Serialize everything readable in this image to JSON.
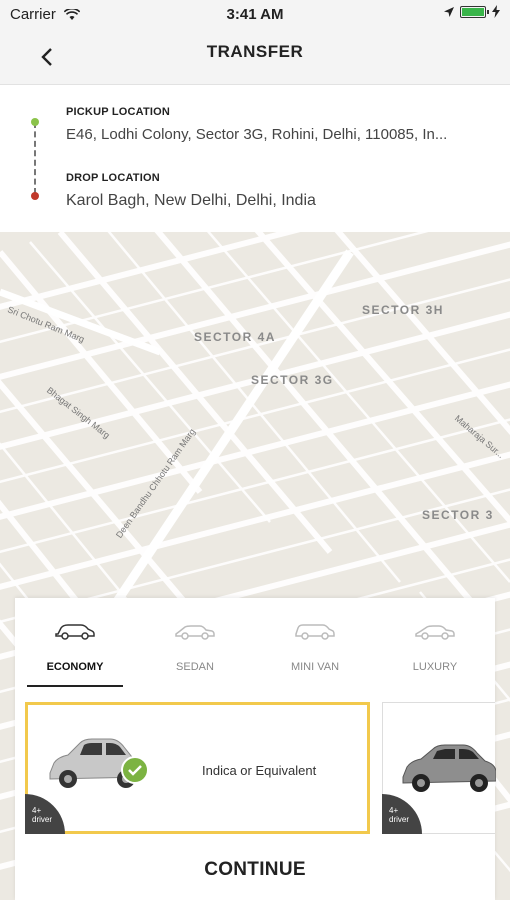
{
  "status_bar": {
    "carrier": "Carrier",
    "time": "3:41 AM",
    "icons": [
      "wifi-icon",
      "location-arrow-icon",
      "battery-icon",
      "charging-icon"
    ],
    "battery_color": "#39b54a"
  },
  "header": {
    "title": "TRANSFER",
    "back_icon": "chevron-left-icon"
  },
  "locations": {
    "pickup_label": "PICKUP LOCATION",
    "pickup_value": "E46, Lodhi Colony, Sector 3G, Rohini, Delhi, 110085, In...",
    "drop_label": "DROP LOCATION",
    "drop_value": "Karol Bagh, New Delhi, Delhi, India",
    "pickup_color": "#8bc34a",
    "drop_color": "#c0392b"
  },
  "map": {
    "labels": [
      "SECTOR 4A",
      "SECTOR 3H",
      "SECTOR 3G",
      "SECTOR 3"
    ],
    "streets": [
      "Sri Chotu Ram Marg",
      "Bhagat Singh Marg",
      "Deen Bandhu Chhotu Ram Marg",
      "Maharaja Sur..."
    ]
  },
  "vehicle_tabs": [
    {
      "label": "ECONOMY",
      "icon": "economy-car-icon",
      "active": true
    },
    {
      "label": "SEDAN",
      "icon": "sedan-car-icon",
      "active": false
    },
    {
      "label": "MINI VAN",
      "icon": "minivan-car-icon",
      "active": false
    },
    {
      "label": "LUXURY",
      "icon": "luxury-car-icon",
      "active": false
    }
  ],
  "cars": [
    {
      "name": "Indica or Equivalent",
      "capacity": "4+\ndriver",
      "selected": true,
      "color": "#c0c0c0"
    },
    {
      "name": "",
      "capacity": "4+\ndriver",
      "selected": false,
      "color": "#8a8a8a"
    }
  ],
  "accent_color": "#f2c94c",
  "continue_label": "CONTINUE"
}
